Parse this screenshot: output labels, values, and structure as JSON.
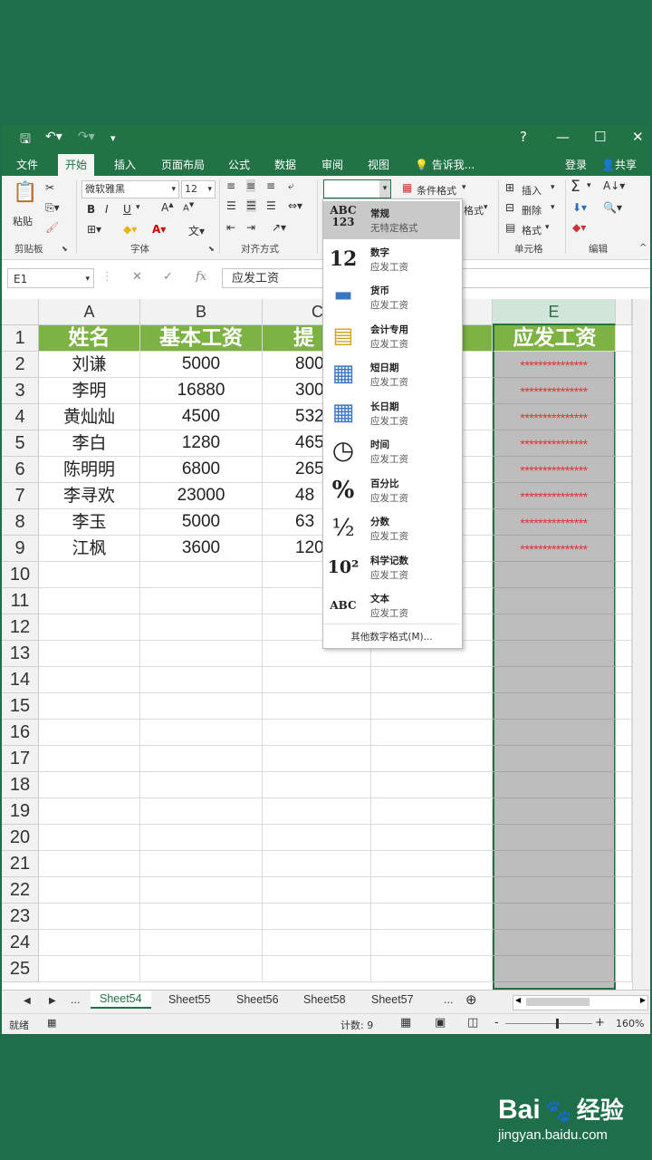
{
  "titlebar": {
    "window_buttons": [
      "?",
      "—",
      "☐",
      "✕"
    ]
  },
  "tabs": [
    "文件",
    "开始",
    "插入",
    "页面布局",
    "公式",
    "数据",
    "审阅",
    "视图"
  ],
  "tell_me": "告诉我...",
  "account": {
    "login": "登录",
    "share": "共享"
  },
  "ribbon": {
    "paste": "粘贴",
    "font_name": "微软雅黑",
    "font_size": "12",
    "bold": "B",
    "italic": "I",
    "underline": "U",
    "cond_format": "条件格式",
    "insert": "插入",
    "delete": "删除",
    "format": "格式",
    "format_partial": "格式",
    "sum": "Σ",
    "groups": [
      "剪贴板",
      "字体",
      "对齐方式",
      "单元格",
      "编辑"
    ]
  },
  "formula_bar": {
    "name_box": "E1",
    "cancel": "✕",
    "enter": "✓",
    "fx": "fx",
    "content": "应发工资"
  },
  "grid": {
    "columns": [
      "A",
      "B",
      "C",
      "E"
    ],
    "rows": [
      "1",
      "2",
      "3",
      "4",
      "5",
      "6",
      "7",
      "8",
      "9",
      "10",
      "11",
      "12",
      "13",
      "14",
      "15",
      "16",
      "17",
      "18",
      "19",
      "20",
      "21",
      "22",
      "23",
      "24",
      "25"
    ],
    "headers": [
      "姓名",
      "基本工资",
      "提成",
      "应发工资"
    ],
    "header_c_visible": "提",
    "data": [
      {
        "name": "刘谦",
        "base": "5000",
        "bonus": "800"
      },
      {
        "name": "李明",
        "base": "16880",
        "bonus": "300"
      },
      {
        "name": "黄灿灿",
        "base": "4500",
        "bonus": "532"
      },
      {
        "name": "李白",
        "base": "1280",
        "bonus": "465"
      },
      {
        "name": "陈明明",
        "base": "6800",
        "bonus": "265"
      },
      {
        "name": "李寻欢",
        "base": "23000",
        "bonus": "48"
      },
      {
        "name": "李玉",
        "base": "5000",
        "bonus": "63"
      },
      {
        "name": "江枫",
        "base": "3600",
        "bonus": "120"
      }
    ],
    "masked_value": "***************"
  },
  "number_format_menu": {
    "items": [
      {
        "icon": "ABC 123",
        "title": "常规",
        "sub": "无特定格式"
      },
      {
        "icon": "12",
        "title": "数字",
        "sub": "应发工资"
      },
      {
        "icon": "currency-icon",
        "title": "货币",
        "sub": "应发工资"
      },
      {
        "icon": "accounting-icon",
        "title": "会计专用",
        "sub": "应发工资"
      },
      {
        "icon": "calendar-icon",
        "title": "短日期",
        "sub": "应发工资"
      },
      {
        "icon": "calendar-icon",
        "title": "长日期",
        "sub": "应发工资"
      },
      {
        "icon": "clock-icon",
        "title": "时间",
        "sub": "应发工资"
      },
      {
        "icon": "%",
        "title": "百分比",
        "sub": "应发工资"
      },
      {
        "icon": "½",
        "title": "分数",
        "sub": "应发工资"
      },
      {
        "icon": "10²",
        "title": "科学记数",
        "sub": "应发工资"
      },
      {
        "icon": "ABC",
        "title": "文本",
        "sub": "应发工资"
      }
    ],
    "more": "其他数字格式(M)..."
  },
  "sheets": [
    "Sheet54",
    "Sheet55",
    "Sheet56",
    "Sheet58",
    "Sheet57"
  ],
  "status": {
    "ready": "就绪",
    "count": "计数: 9",
    "zoom": "160%"
  },
  "watermark": {
    "brand": "Bai",
    "brand2": "经验",
    "url": "jingyan.baidu.com"
  },
  "colors": {
    "excel_green": "#217346",
    "header_fill": "#7cb342",
    "selection": "#bdbdbd",
    "stars": "#dd3333"
  }
}
